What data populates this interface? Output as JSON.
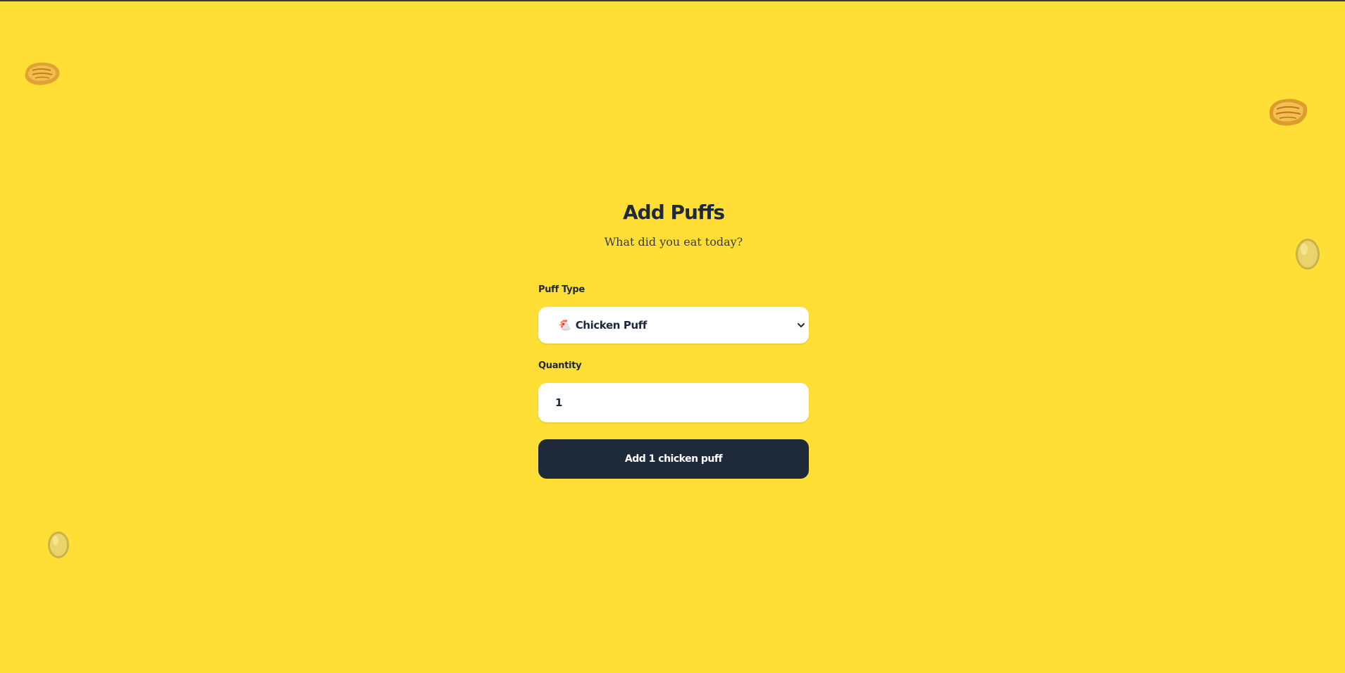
{
  "page": {
    "title": "Add Puffs",
    "subtitle": "What did you eat today?"
  },
  "form": {
    "puff_type_label": "Puff Type",
    "puff_type_selected_emoji": "🐔",
    "puff_type_selected": "Chicken Puff",
    "quantity_label": "Quantity",
    "quantity_value": "1",
    "submit_label": "Add 1 chicken puff"
  },
  "colors": {
    "background": "#FFDF35",
    "text_dark": "#1e2939",
    "button_bg": "#1e2939",
    "button_text": "#ffffff",
    "input_bg": "#ffffff"
  },
  "decorations": [
    "puff-pastry-icon",
    "puff-pastry-icon",
    "egg-icon",
    "egg-icon"
  ]
}
